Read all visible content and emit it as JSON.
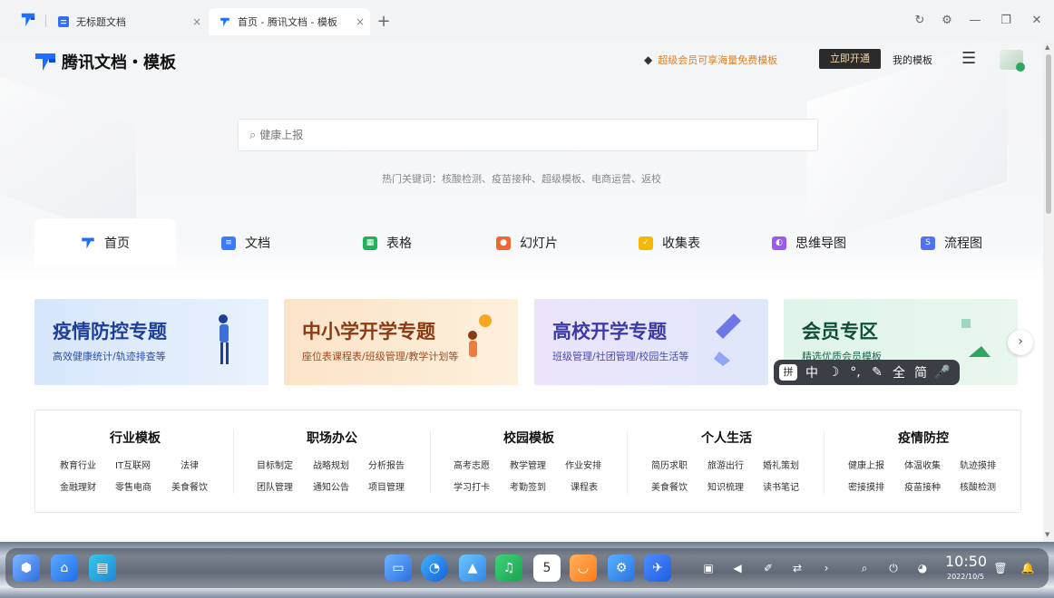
{
  "browser": {
    "tabs": [
      {
        "title": "无标题文档",
        "active": false
      },
      {
        "title": "首页 - 腾讯文档 - 模板",
        "active": true
      }
    ],
    "new_tab": "+",
    "close": "×"
  },
  "header": {
    "brand": "腾讯文档・模板",
    "vip_promo": "超级会员可享海量免费模板",
    "open_button": "立即开通",
    "my_templates": "我的模板"
  },
  "search": {
    "placeholder": "健康上报",
    "hot_prefix": "热门关键词：",
    "hot_keywords": [
      "核酸检测",
      "疫苗接种",
      "超级模板",
      "电商运营",
      "返校"
    ]
  },
  "categories": [
    {
      "label": "首页",
      "icon": "home-logo-icon",
      "color": "#1f6fff"
    },
    {
      "label": "文档",
      "icon": "doc-icon",
      "color": "#3a7afe"
    },
    {
      "label": "表格",
      "icon": "sheet-icon",
      "color": "#1fb25a"
    },
    {
      "label": "幻灯片",
      "icon": "slide-icon",
      "color": "#f2662f"
    },
    {
      "label": "收集表",
      "icon": "form-icon",
      "color": "#f5b800"
    },
    {
      "label": "思维导图",
      "icon": "mindmap-icon",
      "color": "#9b59f0"
    },
    {
      "label": "流程图",
      "icon": "flowchart-icon",
      "color": "#4f73f7"
    }
  ],
  "banners": [
    {
      "title": "疫情防控专题",
      "subtitle": "高效健康统计/轨迹排查等"
    },
    {
      "title": "中小学开学专题",
      "subtitle": "座位表课程表/班级管理/教学计划等"
    },
    {
      "title": "高校开学专题",
      "subtitle": "班级管理/社团管理/校园生活等"
    },
    {
      "title": "会员专区",
      "subtitle": "精选优质会员模板"
    }
  ],
  "ime_toolbar": [
    "拼",
    "中",
    "☽",
    "°,",
    "✎",
    "全",
    "简",
    "🎤"
  ],
  "template_groups": [
    {
      "title": "行业模板",
      "items": [
        "教育行业",
        "IT互联网",
        "法律",
        "金融理财",
        "零售电商",
        "美食餐饮"
      ]
    },
    {
      "title": "职场办公",
      "items": [
        "目标制定",
        "战略规划",
        "分析报告",
        "团队管理",
        "通知公告",
        "项目管理"
      ]
    },
    {
      "title": "校园模板",
      "items": [
        "高考志愿",
        "教学管理",
        "作业安排",
        "学习打卡",
        "考勤签到",
        "课程表"
      ]
    },
    {
      "title": "个人生活",
      "items": [
        "简历求职",
        "旅游出行",
        "婚礼策划",
        "美食餐饮",
        "知识梳理",
        "读书笔记"
      ]
    },
    {
      "title": "疫情防控",
      "items": [
        "健康上报",
        "体温收集",
        "轨迹摸排",
        "密接摸排",
        "疫苗接种",
        "核酸检测"
      ]
    }
  ],
  "taskbar": {
    "time": "10:50",
    "date": "2022/10/5",
    "calendar_day": "5"
  }
}
